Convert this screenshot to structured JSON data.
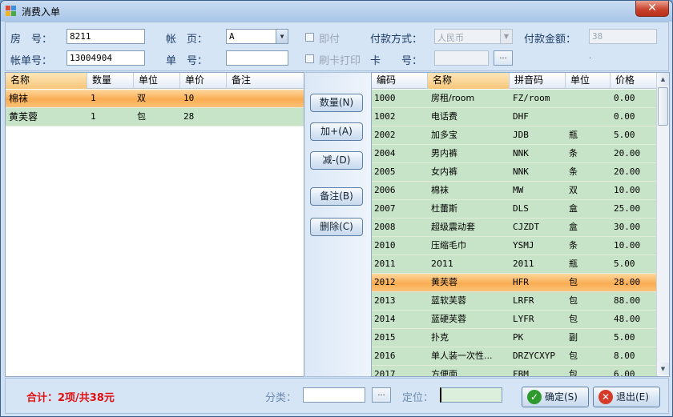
{
  "window": {
    "title": "消费入单",
    "close_glyph": "✕"
  },
  "form": {
    "room_label": "房　号：",
    "room_value": "8211",
    "page_label": "帐　页：",
    "page_value": "A",
    "instant_pay_label": "即付",
    "pay_method_label": "付款方式：",
    "pay_method_value": "人民币",
    "pay_amount_label": "付款金额：",
    "pay_amount_value": "38",
    "bill_no_label": "帐单号：",
    "bill_no_value": "13004904",
    "order_no_label": "单　号：",
    "order_no_value": "",
    "card_print_label": "刷卡打印",
    "card_no_label": "卡　　号：",
    "card_no_value": "",
    "dots": "...",
    "stray_dot": "."
  },
  "order_grid": {
    "headers": [
      "名称",
      "数量",
      "单位",
      "单价",
      "备注"
    ],
    "rows": [
      {
        "name": "棉袜",
        "qty": "1",
        "unit": "双",
        "price": "10",
        "note": ""
      },
      {
        "name": "黄芙蓉",
        "qty": "1",
        "unit": "包",
        "price": "28",
        "note": ""
      }
    ]
  },
  "actions": {
    "quantity": "数量(N)",
    "add": "加+(A)",
    "subtract": "减-(D)",
    "remark": "备注(B)",
    "delete": "删除(C)"
  },
  "product_grid": {
    "headers": [
      "编码",
      "名称",
      "拼音码",
      "单位",
      "价格"
    ],
    "rows": [
      {
        "code": "1000",
        "name": "房租/room",
        "py": "FZ/room",
        "unit": "",
        "price": "0.00"
      },
      {
        "code": "1002",
        "name": "电话费",
        "py": "DHF",
        "unit": "",
        "price": "0.00"
      },
      {
        "code": "2002",
        "name": "加多宝",
        "py": "JDB",
        "unit": "瓶",
        "price": "5.00"
      },
      {
        "code": "2004",
        "name": "男内裤",
        "py": "NNK",
        "unit": "条",
        "price": "20.00"
      },
      {
        "code": "2005",
        "name": "女内裤",
        "py": "NNK",
        "unit": "条",
        "price": "20.00"
      },
      {
        "code": "2006",
        "name": "棉袜",
        "py": "MW",
        "unit": "双",
        "price": "10.00"
      },
      {
        "code": "2007",
        "name": "杜蕾斯",
        "py": "DLS",
        "unit": "盒",
        "price": "25.00"
      },
      {
        "code": "2008",
        "name": "超级震动套",
        "py": "CJZDT",
        "unit": "盒",
        "price": "30.00"
      },
      {
        "code": "2010",
        "name": "压缩毛巾",
        "py": "YSMJ",
        "unit": "条",
        "price": "10.00"
      },
      {
        "code": "2011",
        "name": "2011",
        "py": "2011",
        "unit": "瓶",
        "price": "5.00"
      },
      {
        "code": "2012",
        "name": "黄芙蓉",
        "py": "HFR",
        "unit": "包",
        "price": "28.00"
      },
      {
        "code": "2013",
        "name": "蓝软芙蓉",
        "py": "LRFR",
        "unit": "包",
        "price": "88.00"
      },
      {
        "code": "2014",
        "name": "蓝硬芙蓉",
        "py": "LYFR",
        "unit": "包",
        "price": "48.00"
      },
      {
        "code": "2015",
        "name": "扑克",
        "py": "PK",
        "unit": "副",
        "price": "5.00"
      },
      {
        "code": "2016",
        "name": "单人装一次性...",
        "py": "DRZYCXYP",
        "unit": "包",
        "price": "8.00"
      },
      {
        "code": "2017",
        "name": "方便面",
        "py": "FBM",
        "unit": "包",
        "price": "6.00"
      }
    ],
    "selected_index": 10
  },
  "footer": {
    "total": "合计：2项/共38元",
    "category_label": "分类：",
    "category_value": "",
    "locate_label": "定位：",
    "locate_value": "",
    "ok_label": "确定(S)",
    "exit_label": "退出(E)"
  },
  "colors": {
    "total_red": "#e01010",
    "ok_green": "#2e9a2e",
    "exit_red": "#d63b2a"
  }
}
